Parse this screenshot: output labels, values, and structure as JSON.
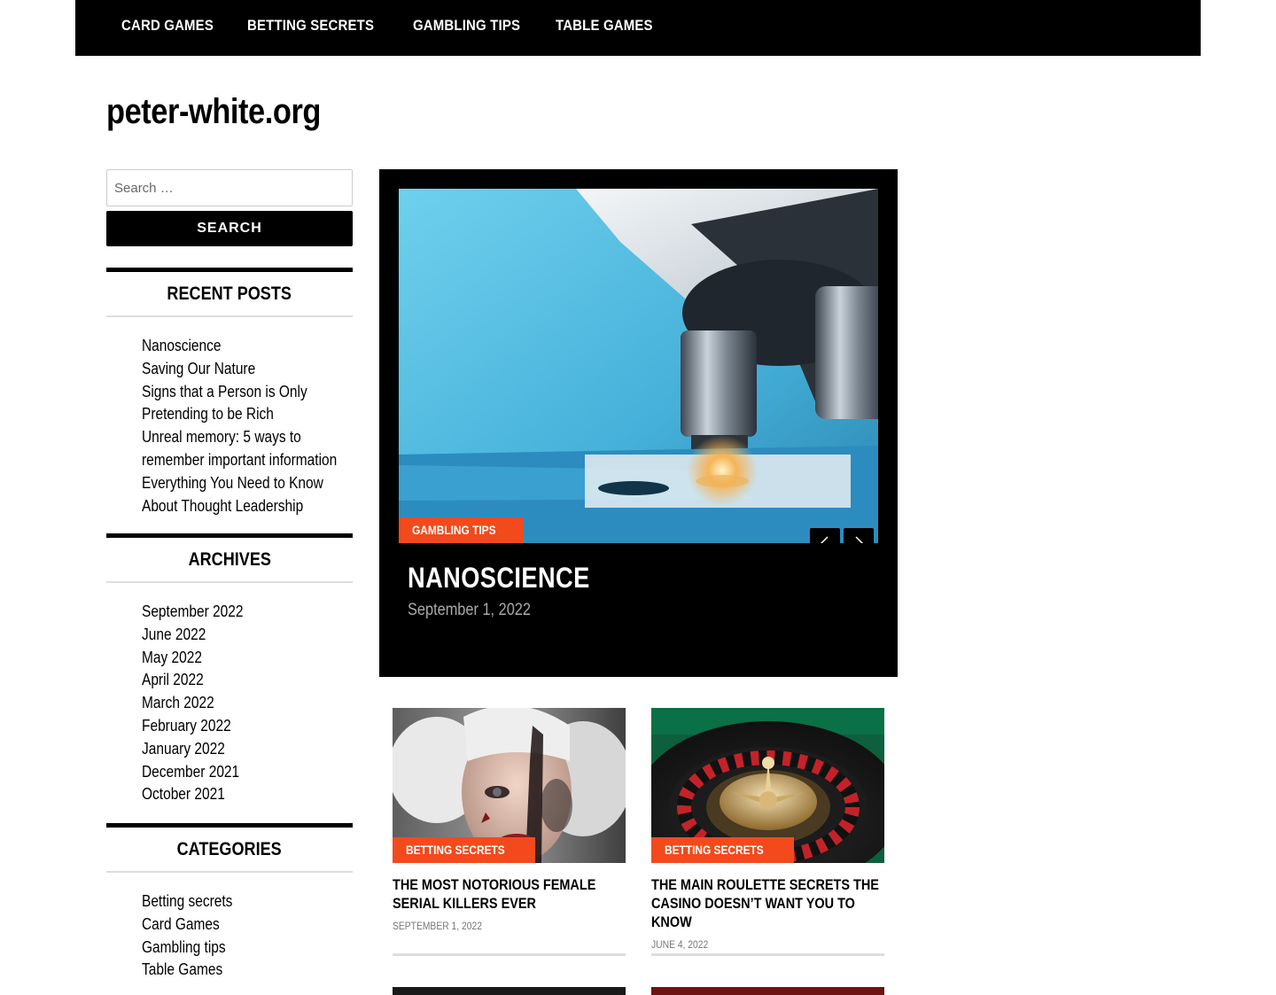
{
  "nav": {
    "items": [
      {
        "label": "Card Games"
      },
      {
        "label": "Betting secrets"
      },
      {
        "label": "Gambling tips"
      },
      {
        "label": "Table Games"
      }
    ]
  },
  "site": {
    "title": "peter-white.org"
  },
  "search": {
    "placeholder": "Search …",
    "button_label": "Search"
  },
  "recent_posts": {
    "title": "Recent Posts",
    "items": [
      {
        "label": "Nanoscience"
      },
      {
        "label": "Saving Our Nature"
      },
      {
        "label": "Signs that a Person is Only Pretending to be Rich"
      },
      {
        "label": "Unreal memory: 5 ways to remember important information"
      },
      {
        "label": "Everything You Need to Know About Thought Leadership"
      }
    ]
  },
  "archives": {
    "title": "Archives",
    "items": [
      {
        "label": "September 2022"
      },
      {
        "label": "June 2022"
      },
      {
        "label": "May 2022"
      },
      {
        "label": "April 2022"
      },
      {
        "label": "March 2022"
      },
      {
        "label": "February 2022"
      },
      {
        "label": "January 2022"
      },
      {
        "label": "December 2021"
      },
      {
        "label": "October 2021"
      }
    ]
  },
  "categories": {
    "title": "Categories",
    "items": [
      {
        "label": "Betting secrets"
      },
      {
        "label": "Card Games"
      },
      {
        "label": "Gambling tips"
      },
      {
        "label": "Table Games"
      }
    ]
  },
  "featured": {
    "category": "Gambling tips",
    "title": "Nanoscience",
    "date": "September 1, 2022",
    "prev_icon": "chevron-left-icon",
    "next_icon": "chevron-right-icon"
  },
  "posts": [
    {
      "category": "Betting secrets",
      "title": "The Most Notorious Female Serial Killers Ever",
      "date": "September 1, 2022"
    },
    {
      "category": "Betting secrets",
      "title": "The Main Roulette Secrets the Casino Doesn’t Want You to Know",
      "date": "June 4, 2022"
    }
  ],
  "colors": {
    "accent": "#f24a1c",
    "nav_bg": "#000000"
  }
}
